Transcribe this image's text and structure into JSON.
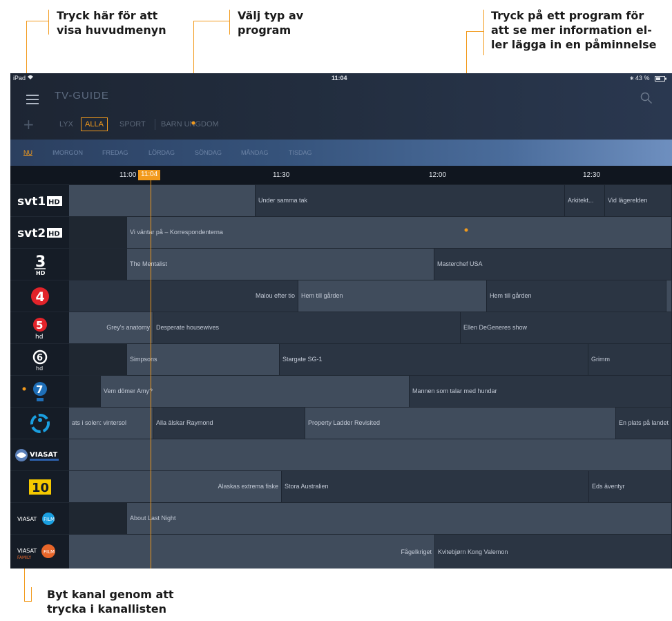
{
  "annotations": {
    "menu": [
      "Tryck här för att",
      "visa huvudmenyn"
    ],
    "type": [
      "Välj typ av",
      "program"
    ],
    "info": [
      "Tryck på ett program för",
      "att se mer information el-",
      "ler lägga in en påminnelse"
    ],
    "channel": [
      "Byt kanal genom att",
      "trycka i kanallisten"
    ]
  },
  "statusbar": {
    "device": "iPad",
    "time": "11:04",
    "battery": "43 %"
  },
  "header": {
    "title": "TV-GUIDE",
    "add_label": "+",
    "categories": [
      "LYX",
      "ALLA",
      "SPORT",
      "BARN UNGDOM"
    ],
    "selected_category": "ALLA",
    "days": [
      "NU",
      "IMORGON",
      "FREDAG",
      "LÖRDAG",
      "SÖNDAG",
      "MÅNDAG",
      "TISDAG"
    ],
    "selected_day": "NU"
  },
  "timeline": {
    "ticks": [
      "11:00",
      "11:30",
      "12:00",
      "12:30"
    ],
    "now": "11:04"
  },
  "channels": [
    {
      "name": "SVT1 HD",
      "programs": [
        {
          "title": ""
        },
        {
          "title": "Under samma tak"
        },
        {
          "title": "Arkitekt..."
        },
        {
          "title": "Vid lägerelden"
        }
      ]
    },
    {
      "name": "SVT2 HD",
      "programs": [
        {
          "title": ""
        },
        {
          "title": "Vi väntar på – Korrespondenterna"
        }
      ]
    },
    {
      "name": "TV3 HD",
      "programs": [
        {
          "title": ""
        },
        {
          "title": "The Mentalist"
        },
        {
          "title": "Masterchef USA"
        }
      ]
    },
    {
      "name": "TV4",
      "programs": [
        {
          "title": "Malou efter tio"
        },
        {
          "title": "Hem till gården"
        },
        {
          "title": "Hem till gården"
        },
        {
          "title": ""
        }
      ]
    },
    {
      "name": "Kanal 5 HD",
      "programs": [
        {
          "title": "Grey's anatomy"
        },
        {
          "title": "Desperate housewives"
        },
        {
          "title": "Ellen DeGeneres show"
        }
      ]
    },
    {
      "name": "TV6 HD",
      "programs": [
        {
          "title": ""
        },
        {
          "title": "Simpsons"
        },
        {
          "title": "Stargate SG-1"
        },
        {
          "title": "Grimm"
        }
      ]
    },
    {
      "name": "Sjuan",
      "programs": [
        {
          "title": ""
        },
        {
          "title": "Vem dömer Amy?"
        },
        {
          "title": "Mannen som talar med hundar"
        }
      ]
    },
    {
      "name": "TV8",
      "programs": [
        {
          "title": "ats i solen: vintersol"
        },
        {
          "title": "Alla älskar Raymond"
        },
        {
          "title": "Property Ladder Revisited"
        },
        {
          "title": "En plats på landet"
        }
      ]
    },
    {
      "name": "Viasat",
      "programs": [
        {
          "title": ""
        }
      ]
    },
    {
      "name": "TV10",
      "programs": [
        {
          "title": "Alaskas extrema fiske"
        },
        {
          "title": "Stora Australien"
        },
        {
          "title": "Eds äventyr"
        }
      ]
    },
    {
      "name": "Viasat Film",
      "programs": [
        {
          "title": ""
        },
        {
          "title": "About Last Night"
        }
      ]
    },
    {
      "name": "Viasat Film Family",
      "programs": [
        {
          "title": "Fågelkriget"
        },
        {
          "title": "Kvitebjørn Kong Valemon"
        }
      ]
    }
  ],
  "colors": {
    "accent": "#f29a1c",
    "background": "#1c2430"
  }
}
